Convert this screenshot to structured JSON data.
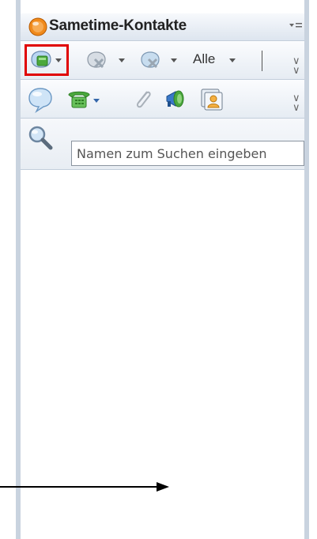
{
  "window": {
    "title": "Sametime-Kontakte"
  },
  "toolbar1": {
    "filter_label": "Alle"
  },
  "search": {
    "placeholder": "Namen zum Suchen eingeben",
    "value": ""
  },
  "icons": {
    "app": "sametime-logo-icon",
    "menu": "panel-menu-icon",
    "status": "status-available-icon",
    "chat": "chat-bubble-icon",
    "call": "telephone-icon",
    "attach": "paperclip-icon",
    "announce": "megaphone-icon",
    "meeting": "contact-card-icon",
    "search": "magnifier-icon"
  },
  "colors": {
    "highlight_box": "#e00000",
    "toolbar_bg": "#e6ecf3",
    "panel_border": "#c9d3df",
    "accent_orange": "#f08a1c",
    "status_green": "#4aa83c"
  }
}
